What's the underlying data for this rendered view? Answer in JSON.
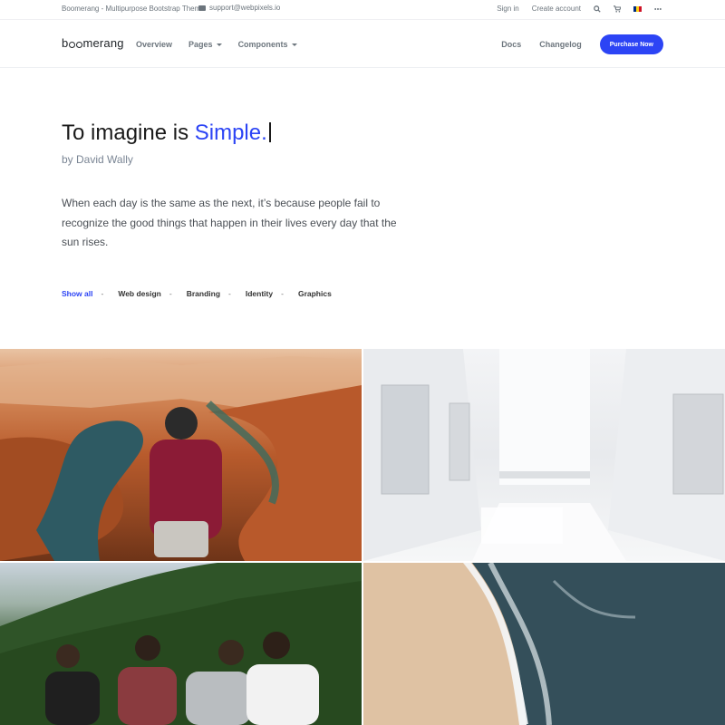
{
  "topbar": {
    "site_title": "Boomerang - Multipurpose Bootstrap Theme",
    "email": "support@webpixels.io",
    "signin": "Sign in",
    "create_account": "Create account",
    "icons": [
      "search-icon",
      "cart-icon",
      "flag-icon",
      "more-icon"
    ]
  },
  "navbar": {
    "logo_parts": [
      "b",
      "merang"
    ],
    "items": [
      {
        "label": "Overview",
        "dropdown": false
      },
      {
        "label": "Pages",
        "dropdown": true
      },
      {
        "label": "Components",
        "dropdown": true
      }
    ],
    "docs": "Docs",
    "changelog": "Changelog",
    "purchase": "Purchase Now"
  },
  "hero": {
    "headline": "To imagine is",
    "headline_accent": "Simple.",
    "byline": "by David Wally",
    "quote": "When each day is the same as the next, it’s because people fail to recognize the good things that happen in their lives every day that the sun rises."
  },
  "filters": {
    "items": [
      "Show all",
      "Web design",
      "Branding",
      "Identity",
      "Graphics"
    ],
    "separator": "-",
    "active_index": 0
  },
  "colors": {
    "accent": "#2c44f5",
    "text": "#212529",
    "muted": "#6c757d"
  }
}
